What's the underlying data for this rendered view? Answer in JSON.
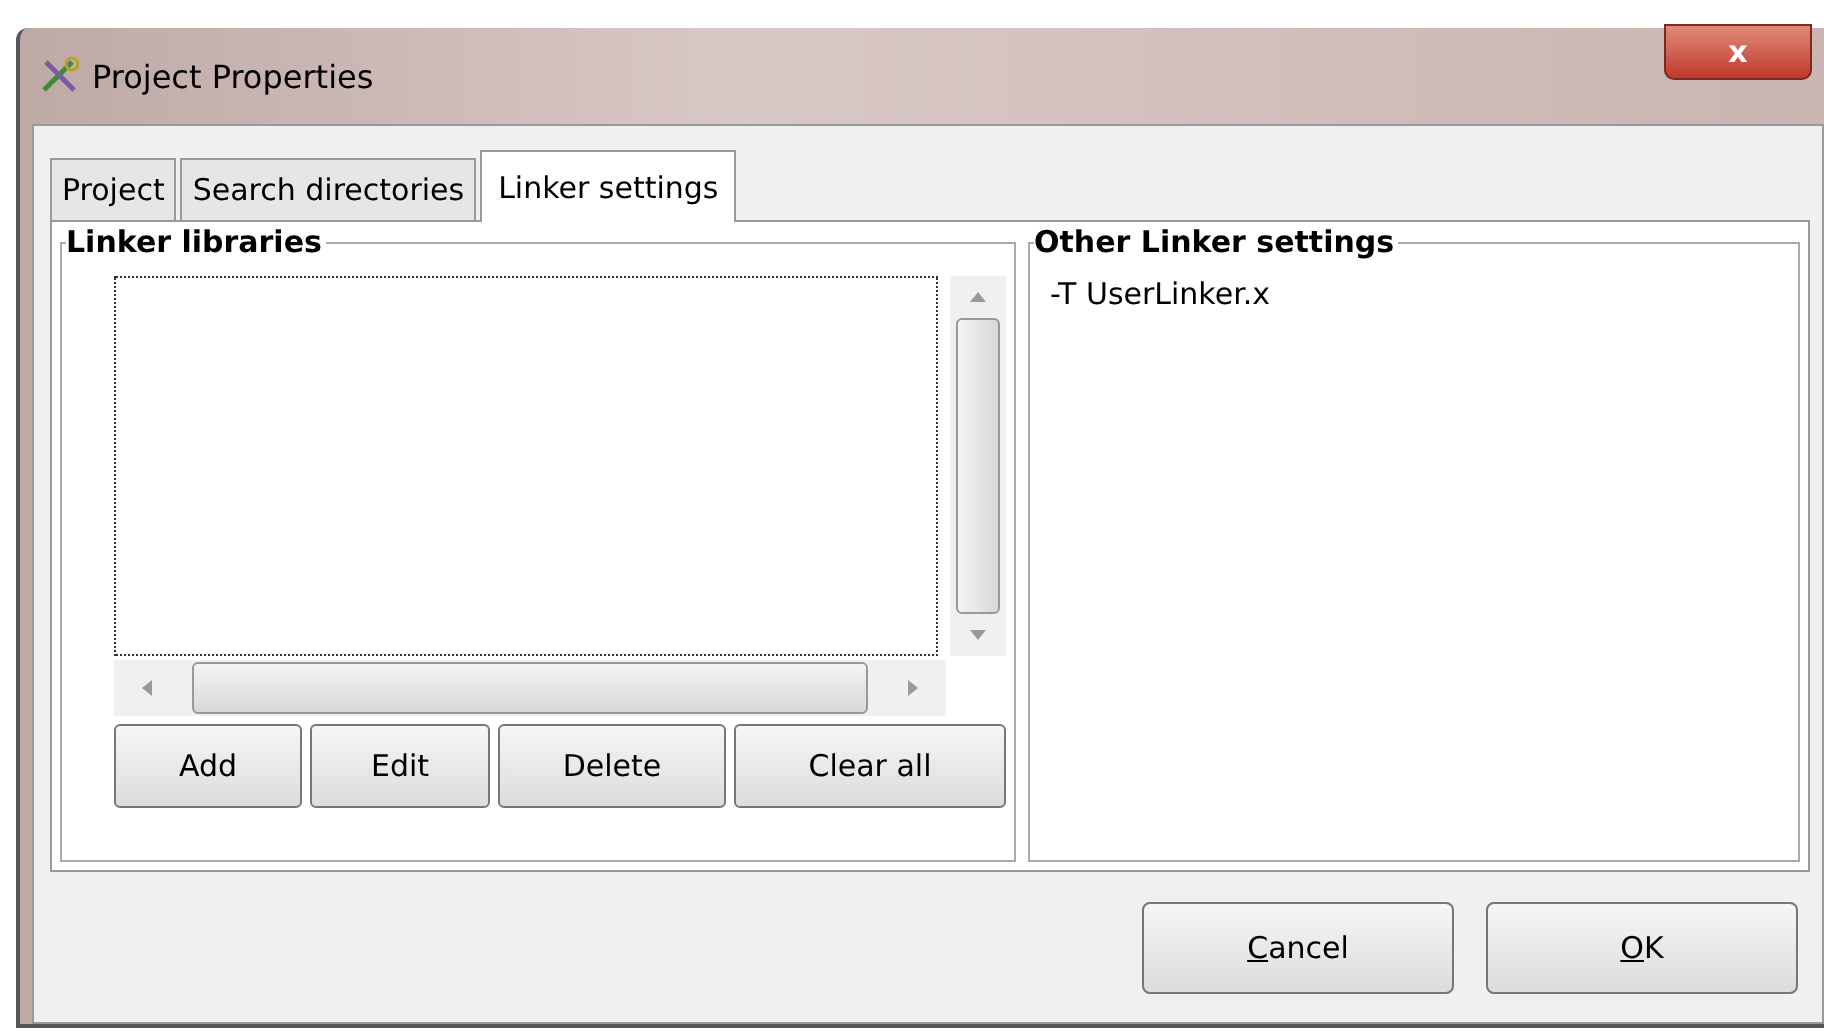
{
  "window": {
    "title": "Project Properties",
    "close": "x"
  },
  "tabs": [
    {
      "label": "Project",
      "selected": false
    },
    {
      "label": "Search directories",
      "selected": false
    },
    {
      "label": "Linker settings",
      "selected": true
    }
  ],
  "linker_libraries": {
    "title": "Linker libraries",
    "focused": true,
    "buttons": [
      "Add",
      "Edit",
      "Delete",
      "Clear all"
    ]
  },
  "other_linker_settings": {
    "title": "Other Linker settings",
    "lines": [
      "-T UserLinker.x"
    ]
  },
  "dialog_buttons": [
    {
      "label": "Cancel",
      "mnemonic_underlined": true
    },
    {
      "label": "OK",
      "mnemonic_underlined": true
    }
  ]
}
